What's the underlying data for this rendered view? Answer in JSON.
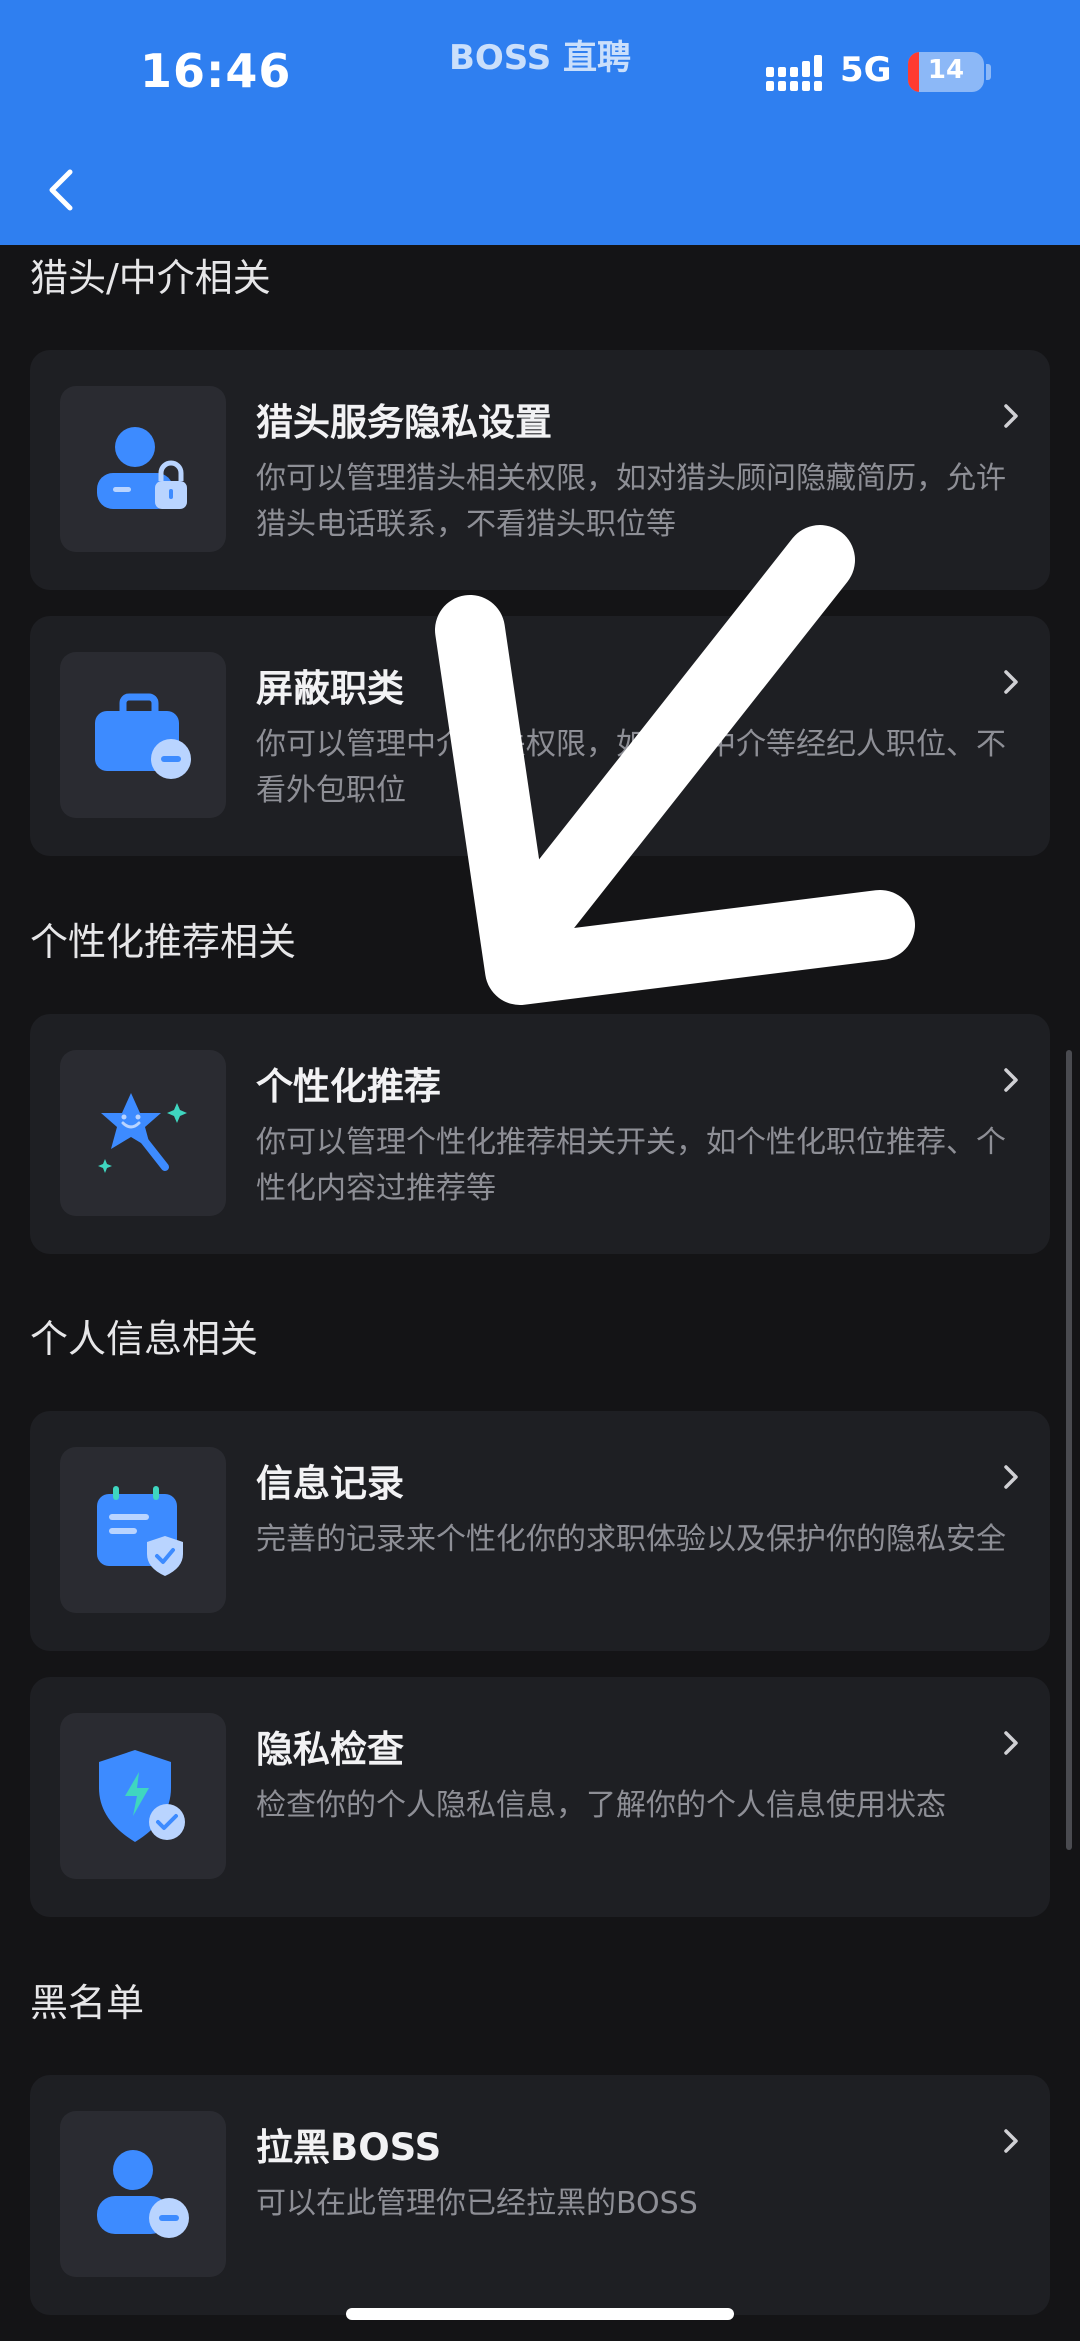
{
  "status_bar": {
    "time": "16:46",
    "app_name": "BOSS 直聘",
    "network": "5G",
    "battery": "14"
  },
  "sections": [
    {
      "title": "猎头/中介相关",
      "items": [
        {
          "title": "猎头服务隐私设置",
          "desc": "你可以管理猎头相关权限，如对猎头顾问隐藏简历，允许猎头电话联系，不看猎头职位等",
          "icon": "user-lock-icon"
        },
        {
          "title": "屏蔽职类",
          "desc": "你可以管理中介相关权限，如屏蔽中介等经纪人职位、不看外包职位",
          "icon": "briefcase-minus-icon"
        }
      ]
    },
    {
      "title": "个性化推荐相关",
      "items": [
        {
          "title": "个性化推荐",
          "desc": "你可以管理个性化推荐相关开关，如个性化职位推荐、个性化内容过推荐等",
          "icon": "star-wand-icon"
        }
      ]
    },
    {
      "title": "个人信息相关",
      "items": [
        {
          "title": "信息记录",
          "desc": "完善的记录来个性化你的求职体验以及保护你的隐私安全",
          "icon": "calendar-check-icon"
        },
        {
          "title": "隐私检查",
          "desc": "检查你的个人隐私信息，了解你的个人信息使用状态",
          "icon": "shield-check-icon"
        }
      ]
    },
    {
      "title": "黑名单",
      "items": [
        {
          "title": "拉黑BOSS",
          "desc": "可以在此管理你已经拉黑的BOSS",
          "icon": "user-minus-icon"
        }
      ]
    }
  ],
  "colors": {
    "header_blue": "#2f7ff0",
    "icon_blue": "#3d8bff",
    "icon_light": "#b9d4ff",
    "card_bg": "#1e1f23",
    "page_bg": "#141416"
  }
}
